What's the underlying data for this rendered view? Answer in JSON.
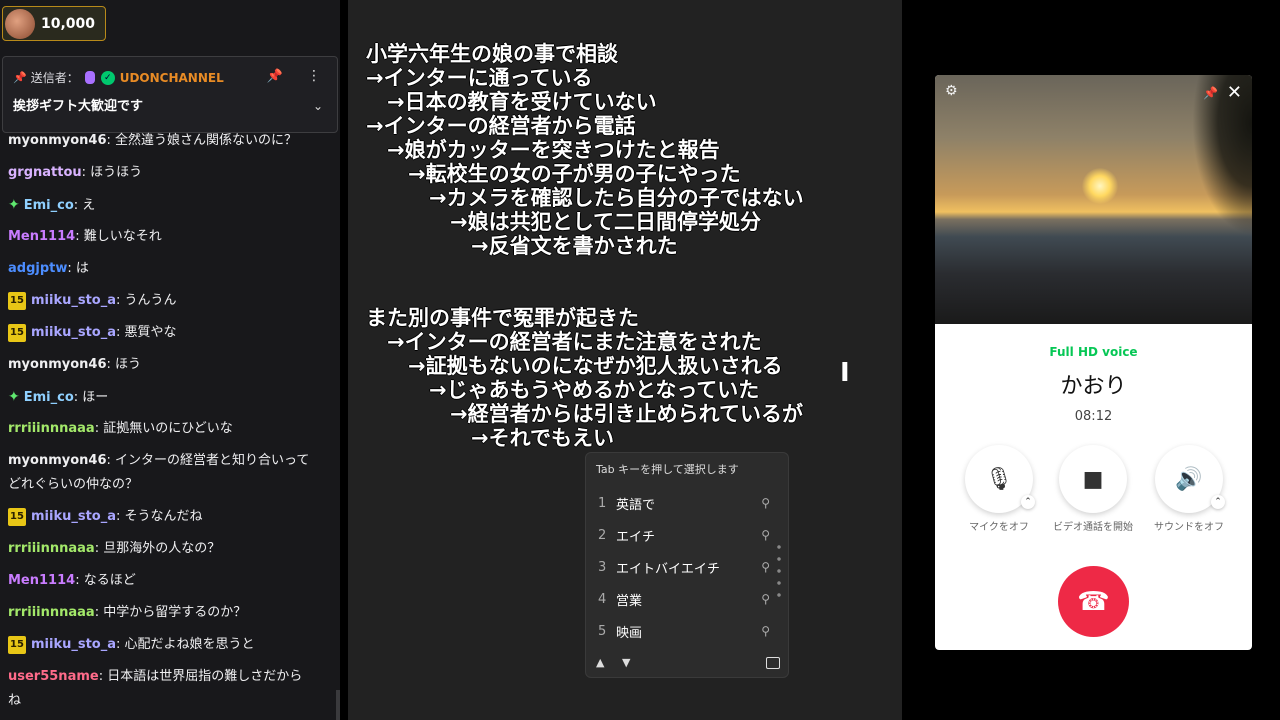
{
  "channel_points": {
    "value": "10,000"
  },
  "pinned": {
    "label": "送信者：",
    "user": "UDONCHANNEL",
    "message": "挨拶ギフト大歓迎です"
  },
  "chat": [
    {
      "user": "myonmyon46",
      "color": "#efeff1",
      "sub": "",
      "spark": false,
      "text": ": 全然違う娘さん関係ないのに？"
    },
    {
      "user": "grgnattou",
      "color": "#d9b3ff",
      "sub": "",
      "spark": false,
      "text": ": ほうほう"
    },
    {
      "user": "Emi_co",
      "color": "#8fd0ff",
      "sub": "",
      "spark": true,
      "text": ": え"
    },
    {
      "user": "Men1114",
      "color": "#c97cff",
      "sub": "",
      "spark": false,
      "text": ": 難しいなそれ"
    },
    {
      "user": "adgjptw",
      "color": "#4c8dff",
      "sub": "",
      "spark": false,
      "text": ": は"
    },
    {
      "user": "miiku_sto_a",
      "color": "#a9a6ff",
      "sub": "15",
      "spark": false,
      "text": ": うんうん"
    },
    {
      "user": "miiku_sto_a",
      "color": "#a9a6ff",
      "sub": "15",
      "spark": false,
      "text": ": 悪質やな"
    },
    {
      "user": "myonmyon46",
      "color": "#efeff1",
      "sub": "",
      "spark": false,
      "text": ": ほう"
    },
    {
      "user": "Emi_co",
      "color": "#8fd0ff",
      "sub": "",
      "spark": true,
      "text": ": ほー"
    },
    {
      "user": "rrriiinnnaaa",
      "color": "#a3e86a",
      "sub": "",
      "spark": false,
      "text": ": 証拠無いのにひどいな"
    },
    {
      "user": "myonmyon46",
      "color": "#efeff1",
      "sub": "",
      "spark": false,
      "text": ": インターの経営者と知り合いって"
    },
    {
      "user": "",
      "color": "#efeff1",
      "sub": "",
      "spark": false,
      "text": "どれぐらいの仲なの？"
    },
    {
      "user": "miiku_sto_a",
      "color": "#a9a6ff",
      "sub": "15",
      "spark": false,
      "text": ": そうなんだね"
    },
    {
      "user": "rrriiinnnaaa",
      "color": "#a3e86a",
      "sub": "",
      "spark": false,
      "text": ": 旦那海外の人なの？"
    },
    {
      "user": "Men1114",
      "color": "#c97cff",
      "sub": "",
      "spark": false,
      "text": ": なるほど"
    },
    {
      "user": "rrriiinnnaaa",
      "color": "#a3e86a",
      "sub": "",
      "spark": false,
      "text": ": 中学から留学するのか？"
    },
    {
      "user": "miiku_sto_a",
      "color": "#a9a6ff",
      "sub": "15",
      "spark": false,
      "text": ": 心配だよね娘を思うと"
    },
    {
      "user": "user55name",
      "color": "#ff6b8a",
      "sub": "",
      "spark": false,
      "text": ": 日本語は世界屈指の難しさだから"
    },
    {
      "user": "",
      "color": "#efeff1",
      "sub": "",
      "spark": false,
      "text": "ね"
    }
  ],
  "notes": [
    "小学六年生の娘の事で相談",
    "→インターに通っている",
    "　→日本の教育を受けていない",
    "→インターの経営者から電話",
    "　→娘がカッターを突きつけたと報告",
    "　　→転校生の女の子が男の子にやった",
    "　　　→カメラを確認したら自分の子ではない",
    "　　　　→娘は共犯として二日間停学処分",
    "　　　　　→反省文を書かされた",
    "また別の事件で冤罪が起きた",
    "　→インターの経営者にまた注意をされた",
    "　　→証拠もないのになぜか犯人扱いされる",
    "　　　→じゃあもうやめるかとなっていた",
    "　　　　→経営者からは引き止められているが",
    "　　　　　→それでもえい"
  ],
  "ime": {
    "hint": "Tab キーを押して選択します",
    "candidates": [
      {
        "num": "1",
        "word": "英語で"
      },
      {
        "num": "2",
        "word": "エイチ"
      },
      {
        "num": "3",
        "word": "エイトバイエイチ"
      },
      {
        "num": "4",
        "word": "営業"
      },
      {
        "num": "5",
        "word": "映画"
      }
    ]
  },
  "call": {
    "quality": "Full HD voice",
    "name": "かおり",
    "time": "08:12",
    "mic_label": "マイクをオフ",
    "video_label": "ビデオ通話を開始",
    "sound_label": "サウンドをオフ"
  },
  "colors": {
    "accent_green": "#06c755",
    "hangup_red": "#ee2946",
    "points_border": "#b88a1a"
  }
}
